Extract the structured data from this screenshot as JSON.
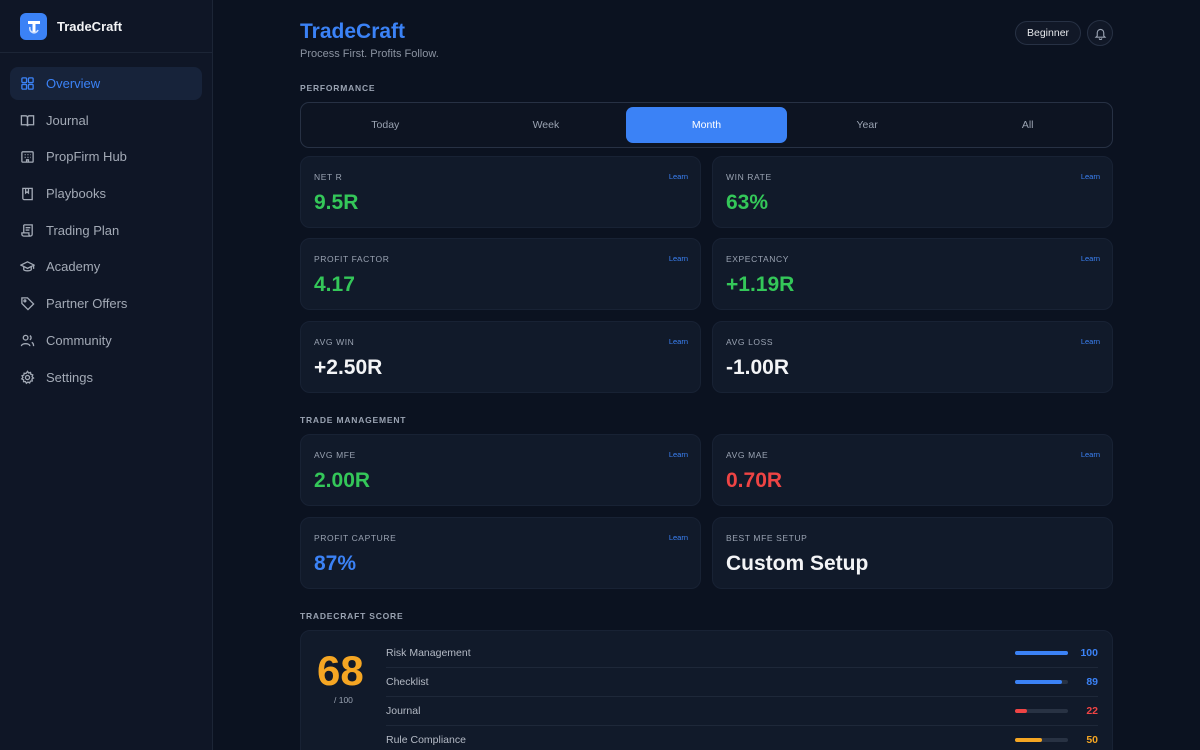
{
  "brand": {
    "name": "TradeCraft"
  },
  "sidebar": {
    "items": [
      {
        "label": "Overview",
        "icon": "grid-icon",
        "active": true
      },
      {
        "label": "Journal",
        "icon": "book-icon"
      },
      {
        "label": "PropFirm Hub",
        "icon": "building-icon"
      },
      {
        "label": "Playbooks",
        "icon": "bookmark-book-icon"
      },
      {
        "label": "Trading Plan",
        "icon": "scroll-icon"
      },
      {
        "label": "Academy",
        "icon": "graduation-cap-icon"
      },
      {
        "label": "Partner Offers",
        "icon": "tag-icon"
      },
      {
        "label": "Community",
        "icon": "users-icon"
      },
      {
        "label": "Settings",
        "icon": "gear-icon"
      }
    ]
  },
  "header": {
    "title": "TradeCraft",
    "subtitle": "Process First. Profits Follow.",
    "level": "Beginner"
  },
  "performance": {
    "section_label": "PERFORMANCE",
    "tabs": [
      "Today",
      "Week",
      "Month",
      "Year",
      "All"
    ],
    "active_tab": "Month",
    "cards": [
      {
        "label": "NET R",
        "value": "9.5R",
        "learn": "Learn",
        "color": "#34c759"
      },
      {
        "label": "WIN RATE",
        "value": "63%",
        "learn": "Learn",
        "color": "#34c759"
      },
      {
        "label": "PROFIT FACTOR",
        "value": "4.17",
        "learn": "Learn",
        "color": "#34c759"
      },
      {
        "label": "EXPECTANCY",
        "value": "+1.19R",
        "learn": "Learn",
        "color": "#34c759"
      },
      {
        "label": "AVG WIN",
        "value": "+2.50R",
        "learn": "Learn",
        "color": "#f3f4f6"
      },
      {
        "label": "AVG LOSS",
        "value": "-1.00R",
        "learn": "Learn",
        "color": "#f3f4f6"
      }
    ]
  },
  "trade_management": {
    "section_label": "TRADE MANAGEMENT",
    "cards": [
      {
        "label": "AVG MFE",
        "value": "2.00R",
        "learn": "Learn",
        "color": "#34c759"
      },
      {
        "label": "AVG MAE",
        "value": "0.70R",
        "learn": "Learn",
        "color": "#ef4444"
      },
      {
        "label": "PROFIT CAPTURE",
        "value": "87%",
        "learn": "Learn",
        "color": "#3b82f6"
      },
      {
        "label": "BEST MFE SETUP",
        "value": "Custom Setup",
        "color": "#f3f4f6"
      }
    ]
  },
  "score": {
    "section_label": "TRADECRAFT SCORE",
    "value": "68",
    "out_of": "/ 100",
    "rows": [
      {
        "label": "Risk Management",
        "score": "100",
        "fraction": 1.0,
        "color": "#3b82f6"
      },
      {
        "label": "Checklist",
        "score": "89",
        "fraction": 0.89,
        "color": "#3b82f6"
      },
      {
        "label": "Journal",
        "score": "22",
        "fraction": 0.22,
        "color": "#ef4444"
      },
      {
        "label": "Rule Compliance",
        "score": "50",
        "fraction": 0.5,
        "color": "#f5a623"
      }
    ]
  }
}
